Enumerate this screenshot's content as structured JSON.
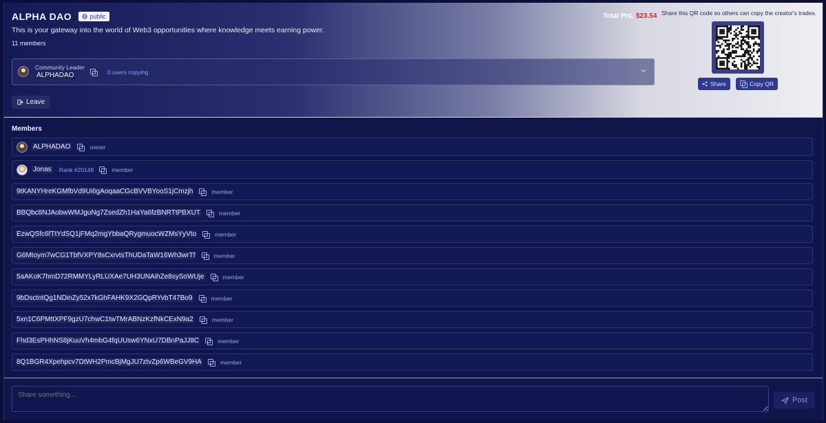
{
  "community": {
    "name": "ALPHA DAO",
    "visibility": "public",
    "description": "This is your gateway into the world of Web3 opportunities where knowledge meets earning power.",
    "members_count": "11 members"
  },
  "leader": {
    "role": "Community Leader",
    "name": "ALPHADAO",
    "users_copying": "0 users copying"
  },
  "actions": {
    "leave": "Leave"
  },
  "pnl": {
    "label": "Total PnL",
    "value": "$23.54",
    "value_color": "#e02424"
  },
  "qr": {
    "caption": "Share this QR code so others can copy the creator's trades.",
    "share_label": "Share",
    "copy_label": "Copy QR"
  },
  "members_section": {
    "title": "Members",
    "members": [
      {
        "name": "ALPHADAO",
        "role": "owner",
        "avatar": "leader-avatar"
      },
      {
        "name": "Jonas",
        "rank": "Rank #20148",
        "role": "member",
        "avatar": "jonas-avatar"
      },
      {
        "name": "9tKANYHreKGMfbVd9Ui6gAoqaaCGcBVVBYooS1jCmzjh",
        "role": "member"
      },
      {
        "name": "BBQbc8NJAobwWMJguNg7ZsedZh1HaYa6fzBNRTtPBXUT",
        "role": "member"
      },
      {
        "name": "EzwQSfc6fTtYdSQ1jFMq2mgYbbaQRygmuocWZMsYyVto",
        "role": "member"
      },
      {
        "name": "G6Mtoym7wCG1TbfVXPY8sCxrvtsThUDaTaW16Wh3wrTf",
        "role": "member"
      },
      {
        "name": "5aAKoK7hmD72RMMYLyRLUXAe7UH3UNAihZe8sySoWUje",
        "role": "member"
      },
      {
        "name": "9bDsctntQg1NDinZy52x7kGhFAHK9X2GQpRYvbT47Bo9",
        "role": "member"
      },
      {
        "name": "5xn1C6PMttXPF9gzU7chwC1twTMrABNzKzfNkCExN9a2",
        "role": "member"
      },
      {
        "name": "Fhd3EsPHhNS8jKuuVh4mbG4fqUUsw6YNxU7DBnPaJJ8C",
        "role": "member"
      },
      {
        "name": "8Q1BGR4Xpehpcv7DtWH2PmcBjMgJU7ztvZp6WBeGV9HA",
        "role": "member"
      }
    ]
  },
  "composer": {
    "placeholder": "Share something...",
    "post_label": "Post"
  }
}
